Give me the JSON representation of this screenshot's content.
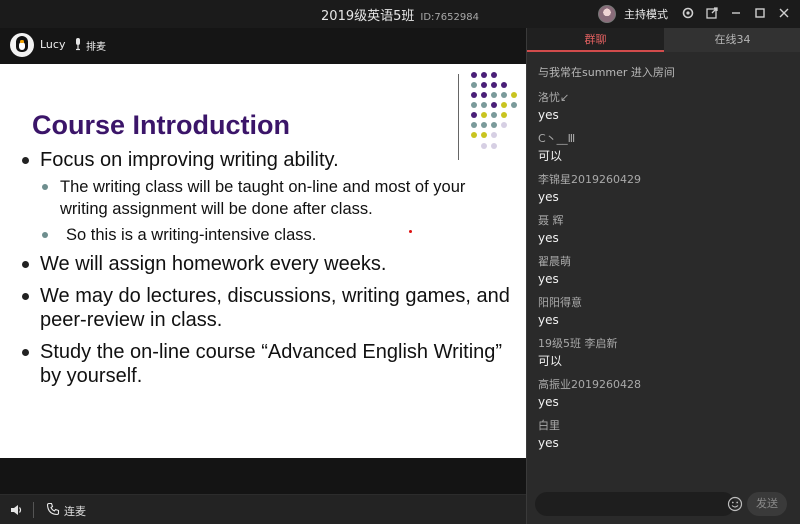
{
  "window": {
    "title": "2019级英语5班",
    "room_id": "ID:7652984",
    "host_mode_label": "主持模式"
  },
  "user": {
    "name": "Lucy",
    "mic_label": "排麦"
  },
  "slide": {
    "title": "Course Introduction",
    "bullets": [
      "Focus on improving writing ability.",
      "The writing class will be taught on-line and most of your writing assignment will be done after class.",
      "So this is a writing-intensive class.",
      "We will assign homework every weeks.",
      "We may do lectures, discussions, writing games, and peer-review in class.",
      "Study the on-line course “Advanced English Writing” by yourself."
    ]
  },
  "bottom": {
    "connect_label": "连麦"
  },
  "chat": {
    "tabs": [
      "群聊",
      "在线34"
    ],
    "system_message": "与我常在summer 进入房间",
    "messages": [
      {
        "name": "洛忧↙",
        "text": "yes"
      },
      {
        "name": "C丶__Ⅲ",
        "text": "可以"
      },
      {
        "name": "李锦星2019260429",
        "text": "yes"
      },
      {
        "name": "聂 辉",
        "text": "yes"
      },
      {
        "name": "翟晨萌",
        "text": "yes"
      },
      {
        "name": "阳阳得意",
        "text": "yes"
      },
      {
        "name": "19级5班 李启新",
        "text": "可以"
      },
      {
        "name": "高振业2019260428",
        "text": "yes"
      },
      {
        "name": "白里",
        "text": "yes"
      }
    ],
    "input_placeholder": "",
    "send_label": "发送"
  },
  "colors": {
    "title_purple": "#3b1569",
    "tab_active_red": "#d24c4c",
    "dot_purple": "#4a1f78",
    "dot_teal": "#7a9a9a",
    "dot_yellow": "#c9c420",
    "dot_lilac": "#d6cfe3"
  },
  "icons": [
    "gear-icon",
    "share-icon",
    "minimize-icon",
    "maximize-icon",
    "close-icon",
    "speaker-icon",
    "phone-icon",
    "emoji-icon",
    "mic-icon"
  ]
}
